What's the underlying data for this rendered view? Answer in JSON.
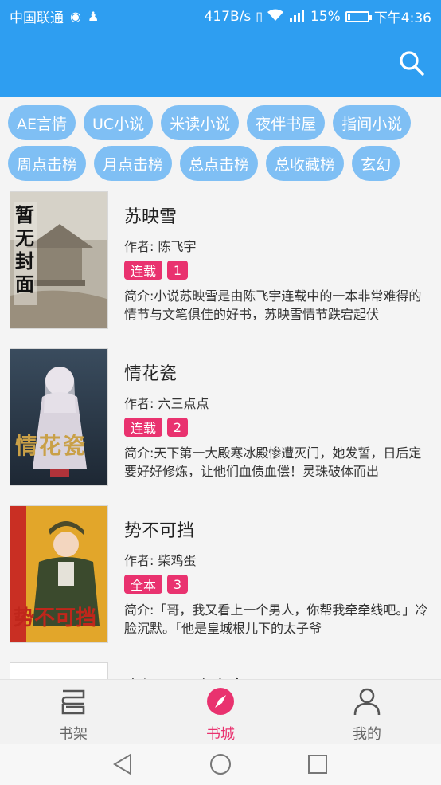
{
  "status_bar": {
    "carrier": "中国联通",
    "network_speed": "417B/s",
    "signal": "4G",
    "battery": "15%",
    "battery_level": 0.15,
    "time": "下午4:36"
  },
  "colors": {
    "primary": "#2e9ef1",
    "chip": "#7fbff4",
    "accent": "#e9326f"
  },
  "categories": [
    [
      "AE言情",
      "UC小说",
      "米读小说",
      "夜伴书屋",
      "指间小说"
    ],
    [
      "周点击榜",
      "月点击榜",
      "总点击榜",
      "总收藏榜",
      "玄幻"
    ]
  ],
  "books": [
    {
      "title": "苏映雪",
      "author": "作者: 陈飞宇",
      "status": "连载",
      "rank": "1",
      "intro": "简介:小说苏映雪是由陈飞宇连载中的一本非常难得的情节与文笔俱佳的好书，苏映雪情节跌宕起伏",
      "cover_text": "暂无封面"
    },
    {
      "title": "情花瓷",
      "author": "作者: 六三点点",
      "status": "连载",
      "rank": "2",
      "intro": "简介:天下第一大殿寒冰殿惨遭灭门，她发誓，日后定要好好修炼，让他们血债血偿！灵珠破体而出",
      "cover_text": "情花瓷"
    },
    {
      "title": "势不可挡",
      "author": "作者: 柴鸡蛋",
      "status": "全本",
      "rank": "3",
      "intro": "简介:「哥，我又看上一个男人，你帮我牵牵线吧。」冷脸沉默。「他是皇城根儿下的太子爷",
      "cover_text": "势不可挡"
    },
    {
      "title": "幸福田园农家女",
      "author": "",
      "status": "",
      "rank": "",
      "intro": "",
      "cover_text": ""
    }
  ],
  "bottom_nav": [
    {
      "label": "书架",
      "icon": "bookshelf-icon"
    },
    {
      "label": "书城",
      "icon": "compass-icon",
      "active": true
    },
    {
      "label": "我的",
      "icon": "person-icon"
    }
  ]
}
